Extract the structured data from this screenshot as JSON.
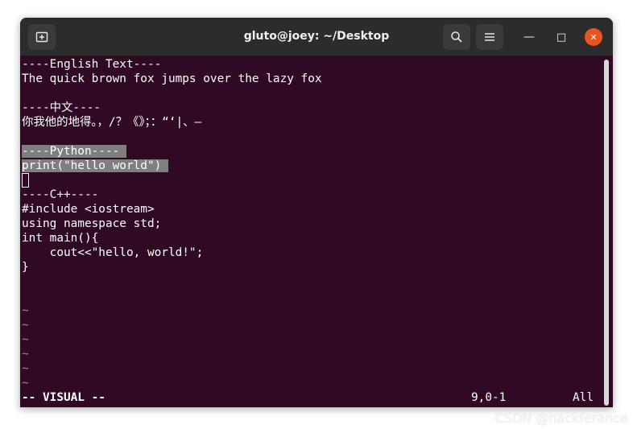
{
  "window": {
    "title": "gluto@joey: ~/Desktop"
  },
  "titlebar": {
    "new_tab_icon": "new-tab-icon",
    "search_icon": "search-icon",
    "menu_icon": "hamburger-menu-icon",
    "minimize_glyph": "—",
    "maximize_glyph": "□",
    "close_glyph": "✕"
  },
  "editor": {
    "lines": [
      "----English Text----",
      "The quick brown fox jumps over the lazy fox",
      "",
      "----中文----",
      "你我他的地得。，/？《》；：“‘|、—",
      "",
      "----Python----",
      "print(\"hello world\")",
      "",
      "----C++----",
      "#include <iostream>",
      "using namespace std;",
      "int main(){",
      "    cout<<\"hello, world!\";",
      "}"
    ],
    "empty_line_markers": [
      "~",
      "~",
      "~",
      "~",
      "~",
      "~"
    ],
    "mode": "-- VISUAL --",
    "cursor_position": "9,0-1",
    "scroll_position": "All"
  },
  "watermark": "CSDN @hackferance",
  "colors": {
    "terminal_bg": "#300a24",
    "titlebar_bg": "#2c2c2c",
    "selection_bg": "#7f7f7f",
    "close_button": "#e95420"
  }
}
